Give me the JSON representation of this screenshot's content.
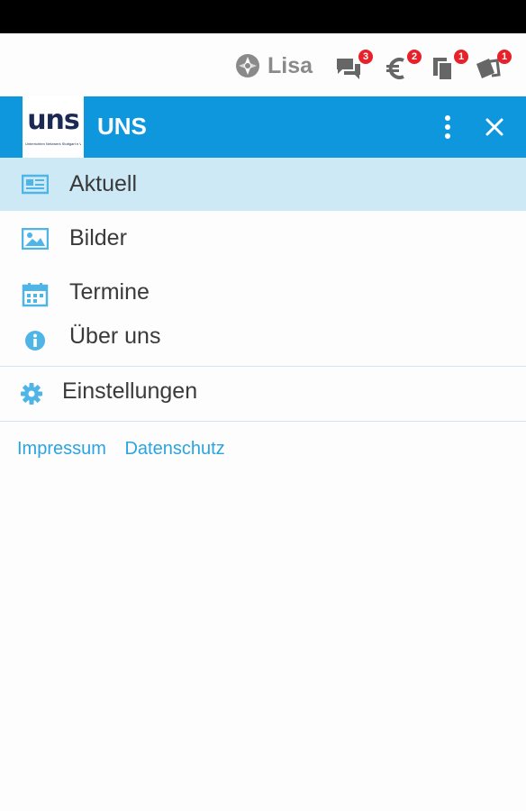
{
  "top_bar": {
    "user_name": "Lisa",
    "notifications": [
      {
        "icon": "chat-icon",
        "count": "3"
      },
      {
        "icon": "euro-icon",
        "count": "2"
      },
      {
        "icon": "documents-icon",
        "count": "1"
      },
      {
        "icon": "tickets-icon",
        "count": "1"
      }
    ]
  },
  "header": {
    "logo_text": "uns",
    "logo_subtitle": "Unterrichten Netzwerk Stuttgart e.V.",
    "title": "UNS"
  },
  "menu": {
    "items": [
      {
        "label": "Aktuell",
        "icon": "newspaper-icon",
        "active": true
      },
      {
        "label": "Bilder",
        "icon": "image-icon"
      },
      {
        "label": "Termine",
        "icon": "calendar-icon"
      },
      {
        "label": "Über uns",
        "icon": "info-icon"
      }
    ],
    "settings_label": "Einstellungen"
  },
  "footer_links": {
    "impressum": "Impressum",
    "datenschutz": "Datenschutz"
  },
  "colors": {
    "primary": "#0e97dc",
    "active_bg": "#cde9f6",
    "icon": "#4fb4e6",
    "badge": "#e8202a"
  }
}
